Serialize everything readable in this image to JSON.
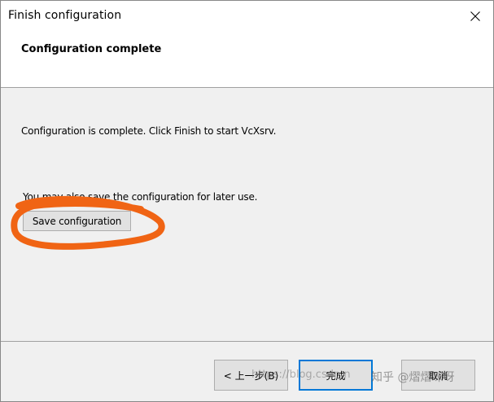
{
  "window": {
    "title": "Finish configuration",
    "close_glyph": "✕"
  },
  "header": {
    "title": "Configuration complete"
  },
  "content": {
    "message": "Configuration is complete. Click Finish to start VcXsrv.",
    "save_hint": "You may also save the configuration for later use.",
    "save_button_label": "Save configuration"
  },
  "footer": {
    "back_label": "< 上一步(B)",
    "finish_label": "完成",
    "cancel_label": "取消"
  },
  "annotation": {
    "color": "#f06414"
  },
  "watermark": {
    "url_text": "https://blog.csdn.n",
    "author_text": "知乎 @熠熠咪呀"
  }
}
